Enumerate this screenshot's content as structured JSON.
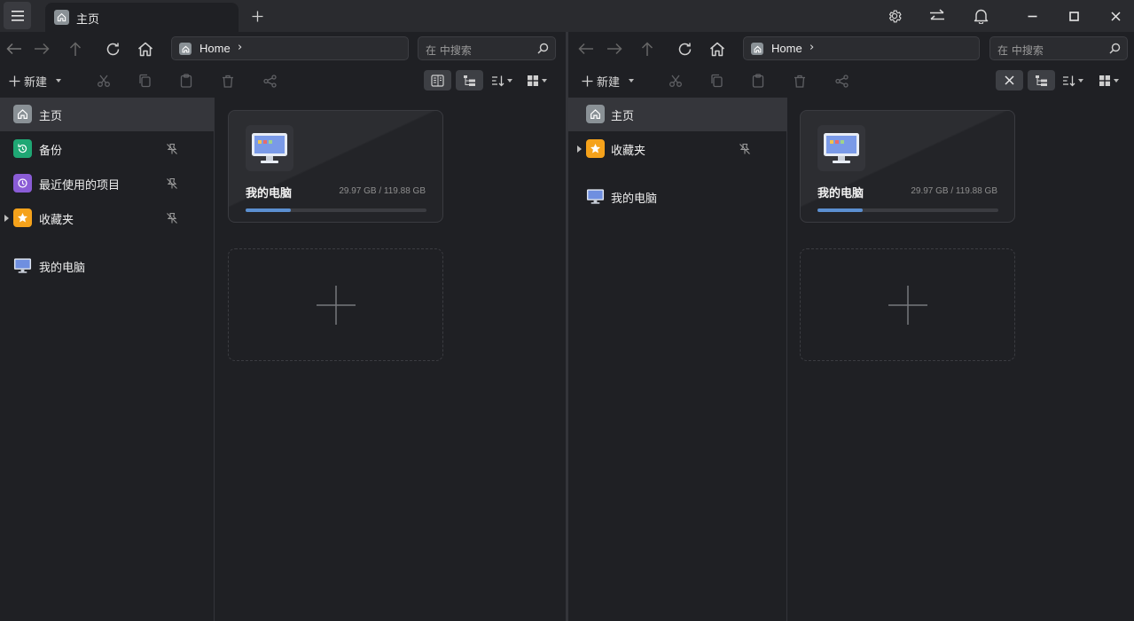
{
  "tab": {
    "label": "主页"
  },
  "address": {
    "text": "Home",
    "chevron": "›"
  },
  "search": {
    "placeholder": "在  中搜索"
  },
  "toolbar": {
    "new_label": "新建"
  },
  "left_sidebar": {
    "items": [
      {
        "label": "主页",
        "icon": "home-icon",
        "color": "#8a9196"
      },
      {
        "label": "备份",
        "icon": "backup-icon",
        "color": "#1fa774"
      },
      {
        "label": "最近使用的项目",
        "icon": "recent-icon",
        "color": "#8a5cd6"
      },
      {
        "label": "收藏夹",
        "icon": "star-icon",
        "color": "#f5a21b"
      },
      {
        "label": "我的电脑",
        "icon": "computer-icon"
      }
    ]
  },
  "right_sidebar": {
    "items": [
      {
        "label": "主页",
        "icon": "home-icon"
      },
      {
        "label": "收藏夹",
        "icon": "star-icon"
      },
      {
        "label": "我的电脑",
        "icon": "computer-icon"
      }
    ]
  },
  "drive": {
    "name": "我的电脑",
    "size": "29.97 GB / 119.88 GB",
    "used_fraction": 0.25
  },
  "colors": {
    "accent": "#5b8fd0",
    "bg": "#1f2024",
    "titlebar": "#2a2b2f"
  }
}
